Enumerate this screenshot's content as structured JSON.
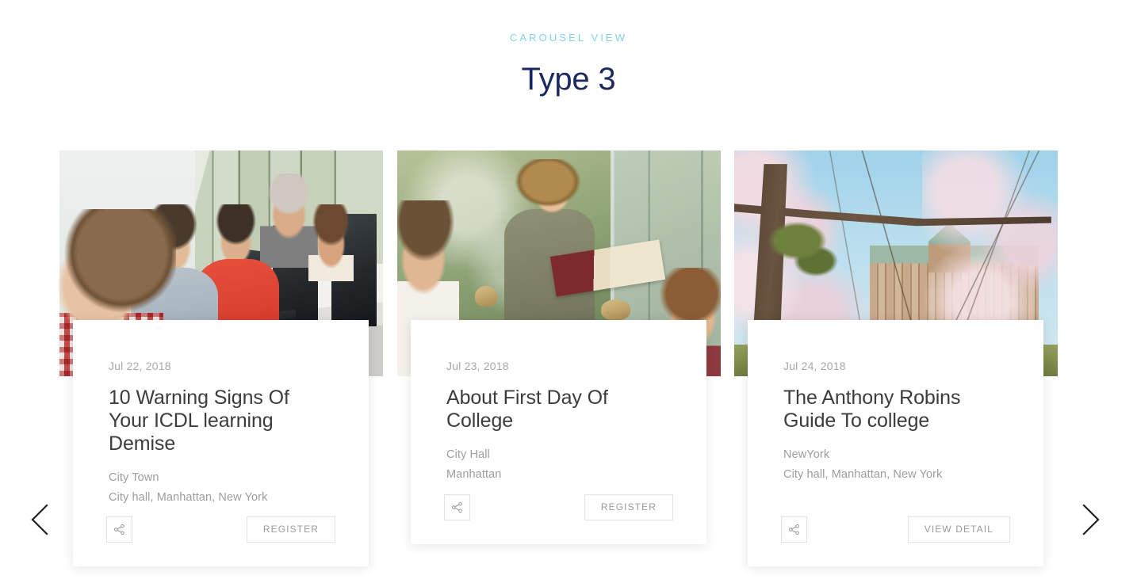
{
  "header": {
    "eyebrow": "CAROUSEL VIEW",
    "title": "Type 3"
  },
  "colors": {
    "eyebrow": "#7fd4ec",
    "title": "#1b2a5e",
    "card_title": "#3c3c3c",
    "muted_text": "#9d9d9d",
    "date_text": "#a8a8a8",
    "button_border": "#e4e4e4",
    "page_background": "#ffffff"
  },
  "nav": {
    "prev_label": "Previous slide",
    "prev_icon": "chevron-left-icon",
    "next_label": "Next slide",
    "next_icon": "chevron-right-icon"
  },
  "carousel": {
    "slides": [
      {
        "date": "Jul 22, 2018",
        "title": "10 Warning Signs Of Your ICDL learning Demise",
        "venue": "City Town",
        "address": "City hall, Manhattan, New York",
        "share_icon": "share-icon",
        "share_label": "Share",
        "cta_label": "REGISTER",
        "image_alt": "Students working at computers in a classroom"
      },
      {
        "date": "Jul 23, 2018",
        "title": "About First Day Of College",
        "venue": "City Hall",
        "address": "Manhattan",
        "share_icon": "share-icon",
        "share_label": "Share",
        "cta_label": "REGISTER",
        "image_alt": "Student reading a book by a library window"
      },
      {
        "date": "Jul 24, 2018",
        "title": "The Anthony Robins Guide To college",
        "venue": "NewYork",
        "address": "City hall, Manhattan, New York",
        "share_icon": "share-icon",
        "share_label": "Share",
        "cta_label": "VIEW DETAIL",
        "image_alt": "Cherry blossom trees in front of a campus building"
      }
    ]
  }
}
